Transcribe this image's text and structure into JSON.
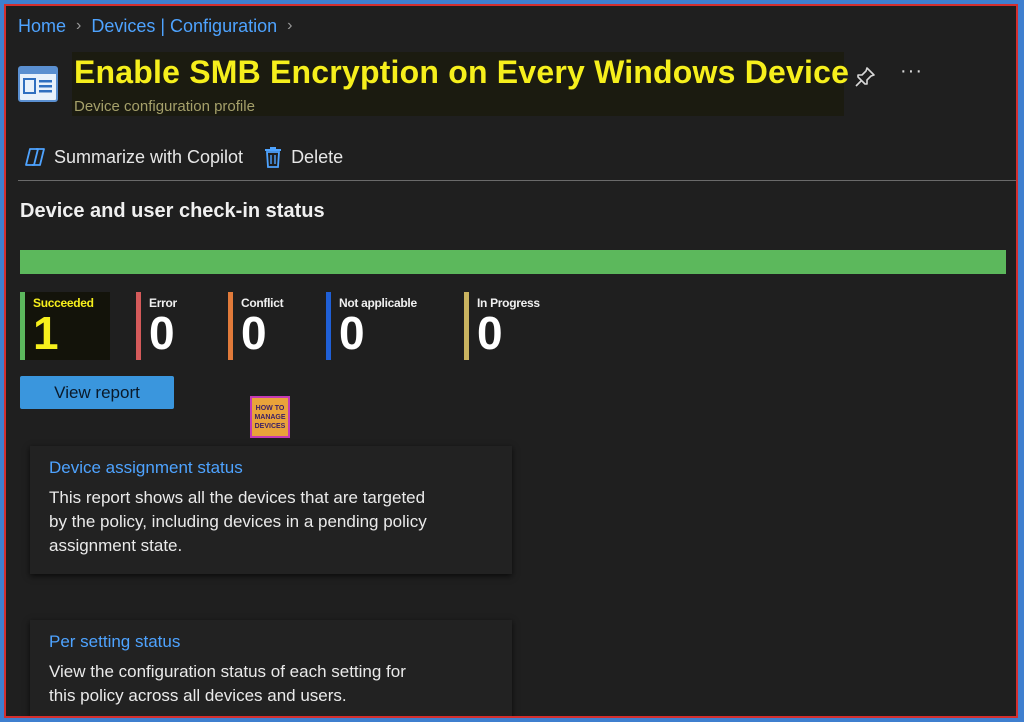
{
  "breadcrumb": {
    "items": [
      "Home",
      "Devices | Configuration"
    ]
  },
  "header": {
    "title": "Enable SMB Encryption on Every Windows Device",
    "subtitle": "Device configuration profile"
  },
  "toolbar": {
    "summarize_label": "Summarize with Copilot",
    "delete_label": "Delete"
  },
  "checkin": {
    "title": "Device and user check-in status",
    "progress_succeeded_fraction": 1.0,
    "statuses": [
      {
        "label": "Succeeded",
        "value": "1",
        "color": "#5cb85c"
      },
      {
        "label": "Error",
        "value": "0",
        "color": "#d45a5a"
      },
      {
        "label": "Conflict",
        "value": "0",
        "color": "#e07a3a"
      },
      {
        "label": "Not applicable",
        "value": "0",
        "color": "#1f5fd6"
      },
      {
        "label": "In Progress",
        "value": "0",
        "color": "#c9b360"
      }
    ],
    "view_report_label": "View report"
  },
  "watermark": {
    "line1": "HOW TO",
    "line2": "MANAGE",
    "line3": "DEVICES"
  },
  "cards": [
    {
      "title": "Device assignment status",
      "body": "This report shows all the devices that are targeted by the policy, including devices in a pending policy assignment state."
    },
    {
      "title": "Per setting status",
      "body": "View the configuration status of each setting for this policy across all devices and users."
    }
  ]
}
